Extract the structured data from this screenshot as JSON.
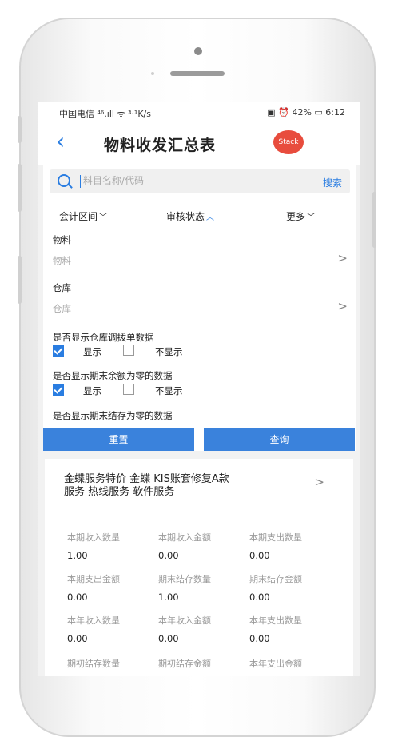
{
  "status": {
    "left": "中国电信 ⁴⁶.ıll ᯤ ³·¹K/s",
    "right": "▣ ⏰ 42% ▭ 6:12"
  },
  "header": {
    "title": "物料收发汇总表",
    "stack_label": "Stack"
  },
  "search": {
    "placeholder": "料目名称/代码",
    "button": "搜索"
  },
  "tabs": [
    {
      "label": "会计区间",
      "chevron": "﹀"
    },
    {
      "label": "审核状态",
      "chevron": "︿"
    },
    {
      "label": "更多",
      "chevron": "﹀"
    }
  ],
  "filters": {
    "material_label": "物料",
    "material_value": "物料",
    "warehouse_label": "仓库",
    "warehouse_value": "仓库",
    "q1": "是否显示仓库调拨单数据",
    "q2": "是否显示期末余额为零的数据",
    "q3": "是否显示期末结存为零的数据",
    "show": "显示",
    "hide": "不显示",
    "arrow": ">"
  },
  "buttons": {
    "reset": "重置",
    "query": "查询"
  },
  "card": {
    "name": "金蝶服务特价 金蝶 KIS账套修复A款服务 热线服务 软件服务",
    "arrow": ">",
    "metrics": [
      {
        "label": "本期收入数量",
        "value": "1.00"
      },
      {
        "label": "本期收入金额",
        "value": "0.00"
      },
      {
        "label": "本期支出数量",
        "value": "0.00"
      },
      {
        "label": "本期支出金额",
        "value": "0.00"
      },
      {
        "label": "期末结存数量",
        "value": "1.00"
      },
      {
        "label": "期末结存金额",
        "value": "0.00"
      },
      {
        "label": "本年收入数量",
        "value": "0.00"
      },
      {
        "label": "本年收入金额",
        "value": "0.00"
      },
      {
        "label": "本年支出数量",
        "value": "0.00"
      },
      {
        "label": "期初结存数量",
        "value": ""
      },
      {
        "label": "期初结存金额",
        "value": ""
      },
      {
        "label": "本年支出金额",
        "value": ""
      }
    ]
  },
  "colors": {
    "accent": "#2a7de1",
    "stack": "#e84c3d",
    "button": "#3a82dc"
  }
}
